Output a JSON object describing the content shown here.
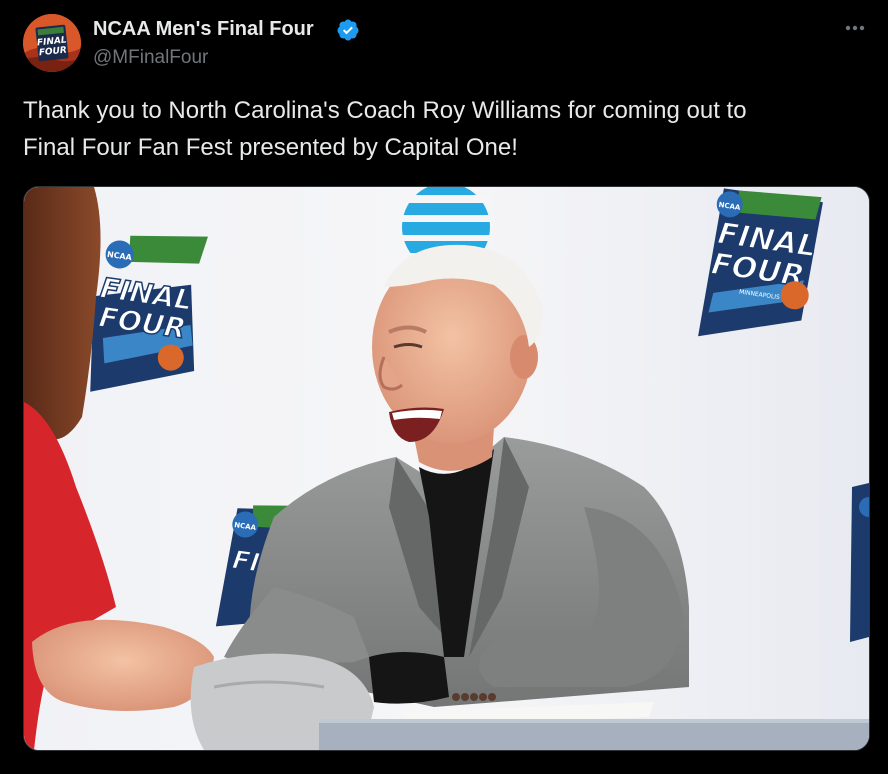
{
  "author": {
    "display_name": "NCAA Men's Final Four",
    "handle": "@MFinalFour",
    "verified": true,
    "avatar_icon": "final-four-logo-icon",
    "avatar_text": [
      "FINAL",
      "FOUR"
    ]
  },
  "tweet": {
    "text": "Thank you to North Carolina's Coach Roy Williams for coming out to\nFinal Four Fan Fest presented by Capital One!"
  },
  "media": {
    "type": "photo",
    "backdrop_logo_text": [
      "FINAL",
      "FOUR"
    ],
    "backdrop_badge_text": "NCAA",
    "backdrop_city_text": "MINNEAPOLIS",
    "sponsor_icon": "att-globe-icon"
  },
  "actions": {
    "more_icon": "more-options-icon"
  },
  "colors": {
    "background": "#000000",
    "text_primary": "#e7e9ea",
    "text_secondary": "#71767b",
    "verified_blue": "#1d9bf0",
    "border": "#2f3336"
  }
}
